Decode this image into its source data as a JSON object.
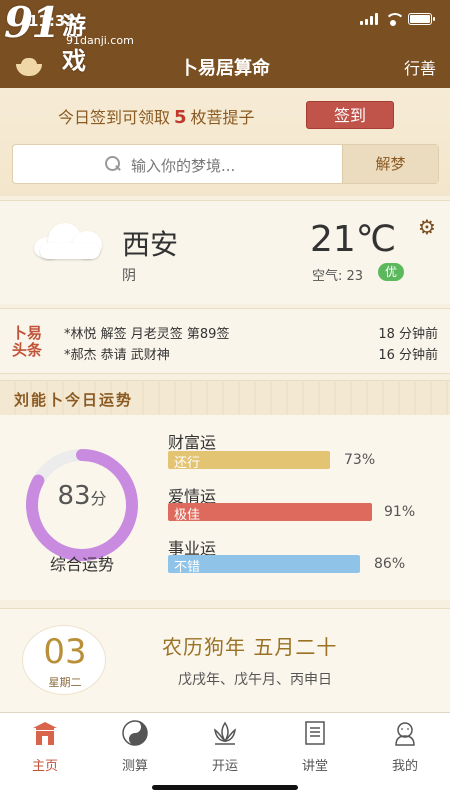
{
  "status": {
    "time": "11:32"
  },
  "watermark": {
    "num": "91",
    "game": "游戏",
    "url": "91danji.com"
  },
  "nav": {
    "title": "卜易居算命",
    "right": "行善"
  },
  "signin": {
    "pre": "今日签到可领取",
    "count": "5",
    "post": "枚菩提子",
    "button": "签到"
  },
  "dream": {
    "placeholder": "输入你的梦境...",
    "button": "解梦"
  },
  "weather": {
    "city": "西安",
    "condition": "阴",
    "temp": "21℃",
    "air_label": "空气: 23",
    "air_level": "优"
  },
  "headlines": {
    "logo": "卜易头条",
    "items": [
      {
        "text": "*林悦  解签  月老灵签 第89签",
        "time": "18 分钟前"
      },
      {
        "text": "*郝杰  恭请  武财神",
        "time": "16 分钟前"
      }
    ]
  },
  "fortune": {
    "title": "刘能卜今日运势",
    "score": "83",
    "score_unit": "分",
    "score_label": "综合运势",
    "score_value": 83,
    "bars": [
      {
        "name": "财富运",
        "level": "还行",
        "pct": "73%",
        "value": 73,
        "color": "#e3c472"
      },
      {
        "name": "爱情运",
        "level": "极佳",
        "pct": "91%",
        "value": 91,
        "color": "#de6a5e"
      },
      {
        "name": "事业运",
        "level": "不错",
        "pct": "86%",
        "value": 86,
        "color": "#8fc3e8"
      }
    ]
  },
  "calendar": {
    "day": "03",
    "week": "星期二",
    "lunar": "农历狗年 五月二十",
    "ganzhi": "戊戌年、戊午月、丙申日"
  },
  "tabs": [
    {
      "label": "主页",
      "icon": "temple-icon"
    },
    {
      "label": "测算",
      "icon": "taiji-icon"
    },
    {
      "label": "开运",
      "icon": "lotus-icon"
    },
    {
      "label": "讲堂",
      "icon": "book-icon"
    },
    {
      "label": "我的",
      "icon": "monk-icon"
    }
  ]
}
